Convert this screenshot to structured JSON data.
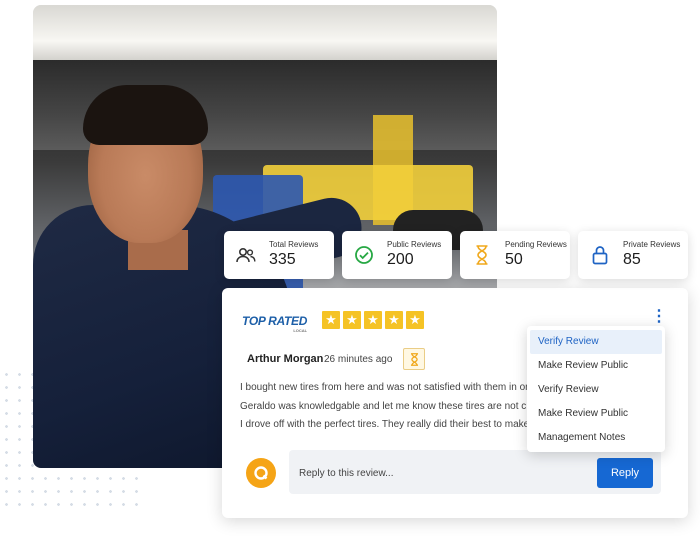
{
  "stats": [
    {
      "label": "Total Reviews",
      "value": "335",
      "icon": "users-icon"
    },
    {
      "label": "Public Reviews",
      "value": "200",
      "icon": "check-circle-icon"
    },
    {
      "label": "Pending Reviews",
      "value": "50",
      "icon": "hourglass-icon"
    },
    {
      "label": "Private Reviews",
      "value": "85",
      "icon": "lock-icon"
    }
  ],
  "review": {
    "source_logo": "TOP RATED",
    "source_logo_sub": "LOCAL",
    "rating": 5,
    "reviewer": "Arthur Morgan",
    "time": "26 minutes ago",
    "status_icon": "hourglass-icon",
    "body": [
      "I bought new tires from here and was not satisfied with them in or",
      "Geraldo was knowledgable and let me know these tires are  not c",
      "I drove off with the perfect tires. They really did their best to make"
    ]
  },
  "reply": {
    "placeholder": "Reply to this review...",
    "button_label": "Reply"
  },
  "menu": {
    "items": [
      "Verify Review",
      "Make Review Public",
      "Verify Review",
      "Make Review Public",
      "Management Notes"
    ],
    "active_index": 0
  },
  "colors": {
    "accent": "#1668d3",
    "star": "#f5c325",
    "green": "#27a844",
    "pending": "#f0a81c",
    "avatar": "#f5a416"
  }
}
